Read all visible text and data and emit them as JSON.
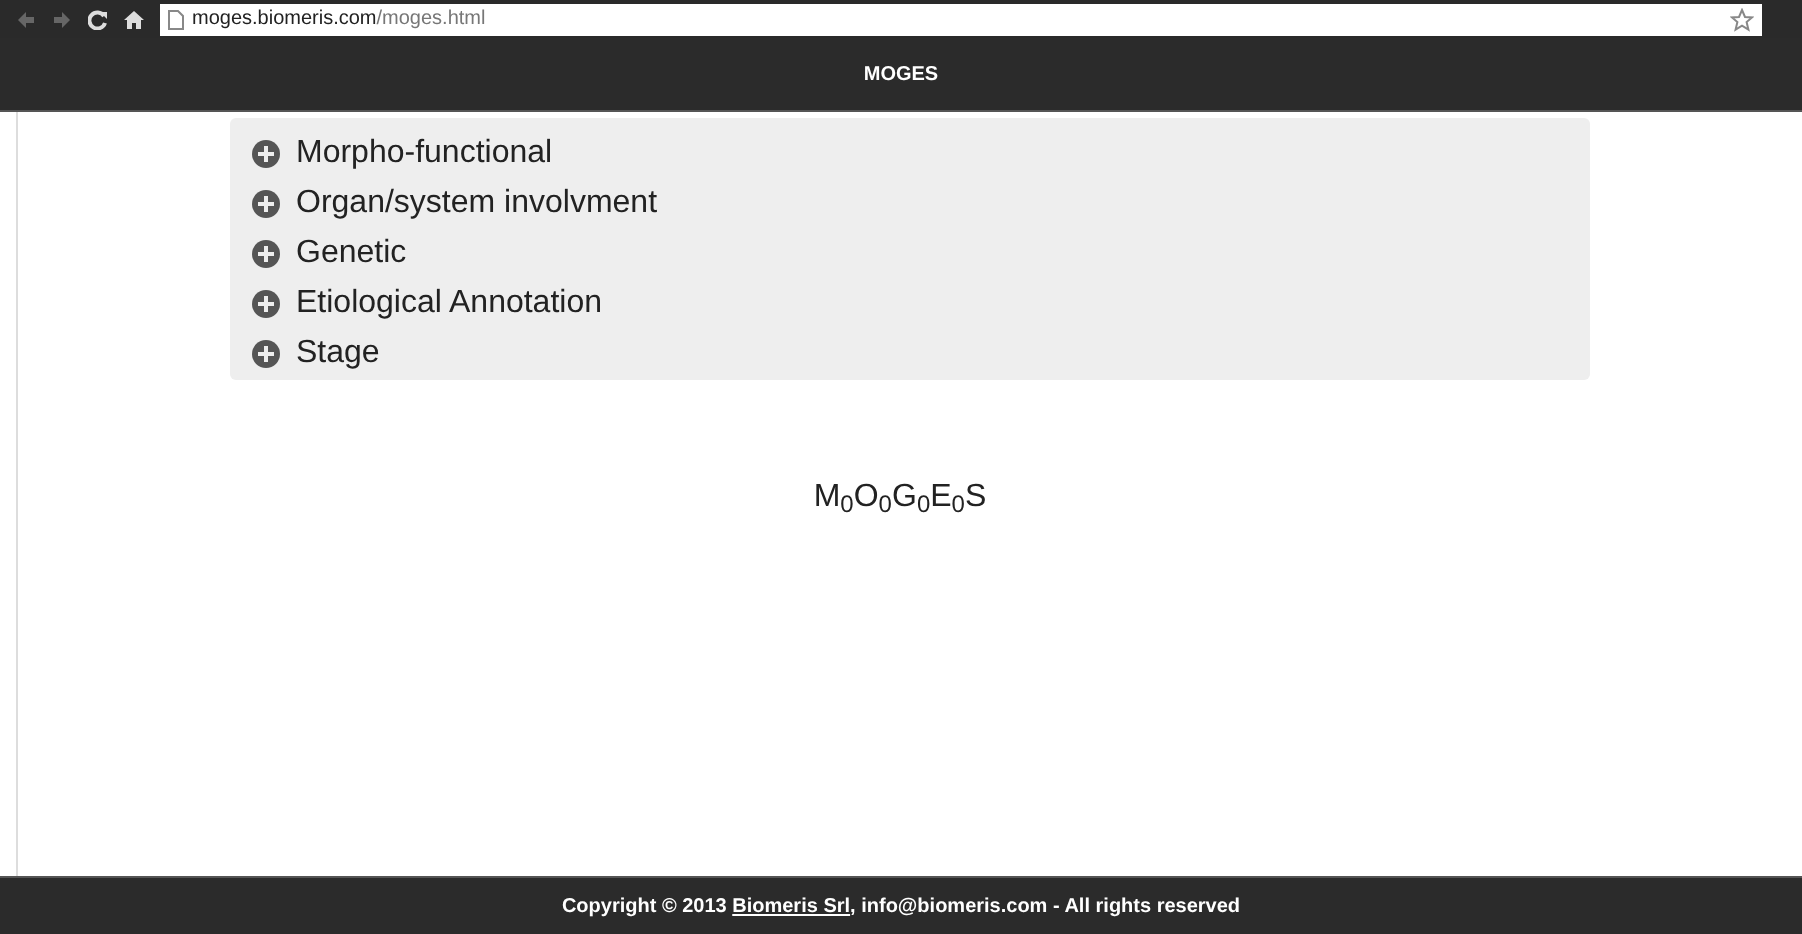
{
  "browser": {
    "url_host": "moges.biomeris.com",
    "url_path": "/moges.html"
  },
  "navbar": {
    "title": "MOGES"
  },
  "accordion": [
    {
      "label": "Morpho-functional",
      "expanded": false
    },
    {
      "label": "Organ/system involvment",
      "expanded": false
    },
    {
      "label": "Genetic",
      "expanded": false
    },
    {
      "label": "Etiological Annotation",
      "expanded": false
    },
    {
      "label": "Stage",
      "expanded": false
    }
  ],
  "formula": "M$_{0}$O$_{0}$G$_{0}$E$_{0}$S",
  "footer": {
    "prefix": "Copyright © 2013",
    "link": "Biomeris Srl",
    "suffix": ", info@biomeris.com - All rights reserved"
  }
}
